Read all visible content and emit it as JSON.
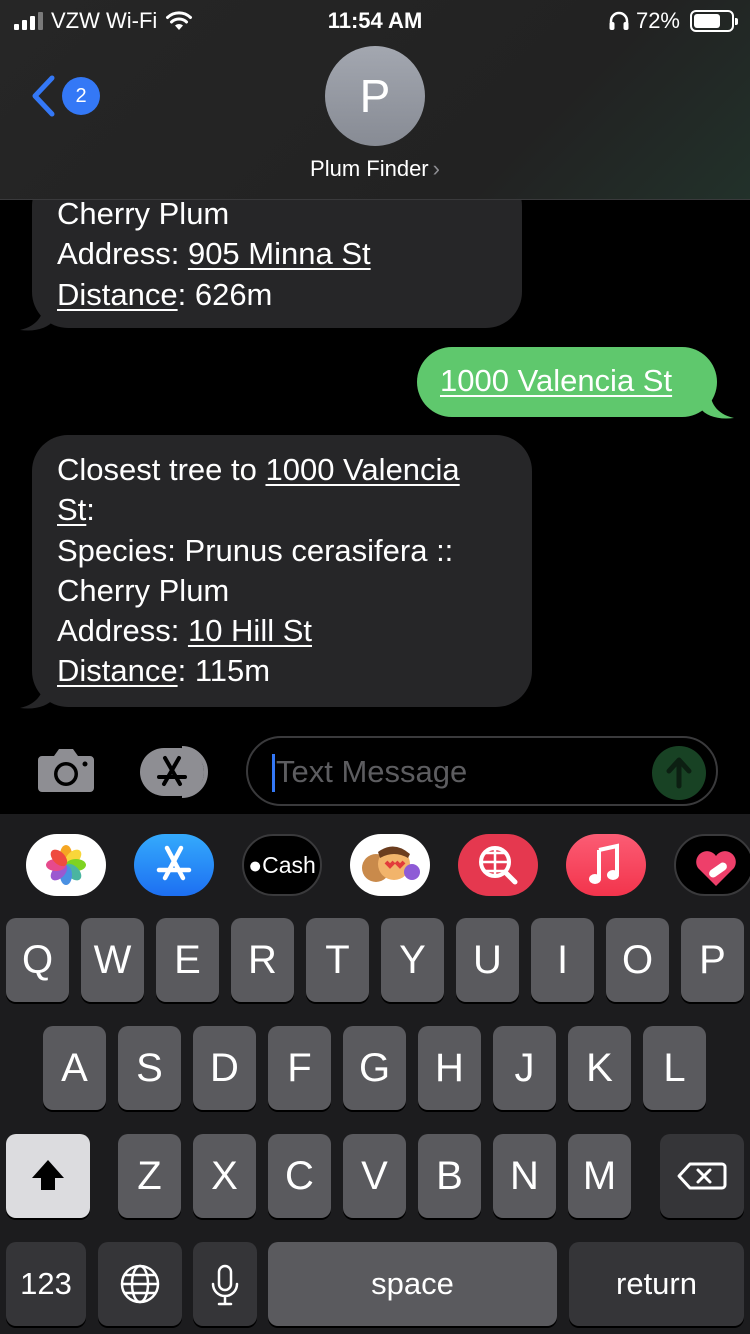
{
  "status_bar": {
    "carrier": "VZW Wi-Fi",
    "time": "11:54 AM",
    "battery_percent": "72%",
    "battery_level": 0.72
  },
  "header": {
    "back_badge_count": "2",
    "avatar_initial": "P",
    "contact_name": "Plum Finder",
    "chevron": "›"
  },
  "messages": [
    {
      "direction": "incoming",
      "lines": [
        [
          {
            "t": "Cherry Plum"
          }
        ],
        [
          {
            "t": "Address: "
          },
          {
            "t": "905 Minna St",
            "u": true
          }
        ],
        [
          {
            "t": "Distance",
            "u": true
          },
          {
            "t": ": 626m"
          }
        ]
      ]
    },
    {
      "direction": "outgoing",
      "lines": [
        [
          {
            "t": "1000 Valencia St",
            "u": true
          }
        ]
      ]
    },
    {
      "direction": "incoming",
      "lines": [
        [
          {
            "t": "Closest tree to "
          },
          {
            "t": "1000 Valencia",
            "u": true
          }
        ],
        [
          {
            "t": "St",
            "u": true
          },
          {
            "t": ":"
          }
        ],
        [
          {
            "t": "Species: Prunus cerasifera ::"
          }
        ],
        [
          {
            "t": "Cherry Plum"
          }
        ],
        [
          {
            "t": "Address: "
          },
          {
            "t": "10 Hill St",
            "u": true
          }
        ],
        [
          {
            "t": "Distance",
            "u": true
          },
          {
            "t": ": 115m"
          }
        ]
      ]
    }
  ],
  "compose": {
    "placeholder": "Text Message"
  },
  "app_drawer": [
    {
      "name": "photos-app-icon",
      "label": ""
    },
    {
      "name": "app-store-app-icon",
      "label": ""
    },
    {
      "name": "apple-cash-app-icon",
      "label": "Cash"
    },
    {
      "name": "memoji-app-icon",
      "label": ""
    },
    {
      "name": "web-search-app-icon",
      "label": ""
    },
    {
      "name": "music-app-icon",
      "label": ""
    },
    {
      "name": "digital-touch-app-icon",
      "label": ""
    }
  ],
  "keyboard": {
    "row1": [
      "Q",
      "W",
      "E",
      "R",
      "T",
      "Y",
      "U",
      "I",
      "O",
      "P"
    ],
    "row2": [
      "A",
      "S",
      "D",
      "F",
      "G",
      "H",
      "J",
      "K",
      "L"
    ],
    "row3": [
      "Z",
      "X",
      "C",
      "V",
      "B",
      "N",
      "M"
    ],
    "numbers_key": "123",
    "space_key": "space",
    "return_key": "return"
  },
  "colors": {
    "incoming_bubble": "#262628",
    "outgoing_bubble": "#5fc86d",
    "accent_blue": "#3478f6",
    "keyboard_bg": "#1c1c1e",
    "key": "#5a5a5e"
  }
}
